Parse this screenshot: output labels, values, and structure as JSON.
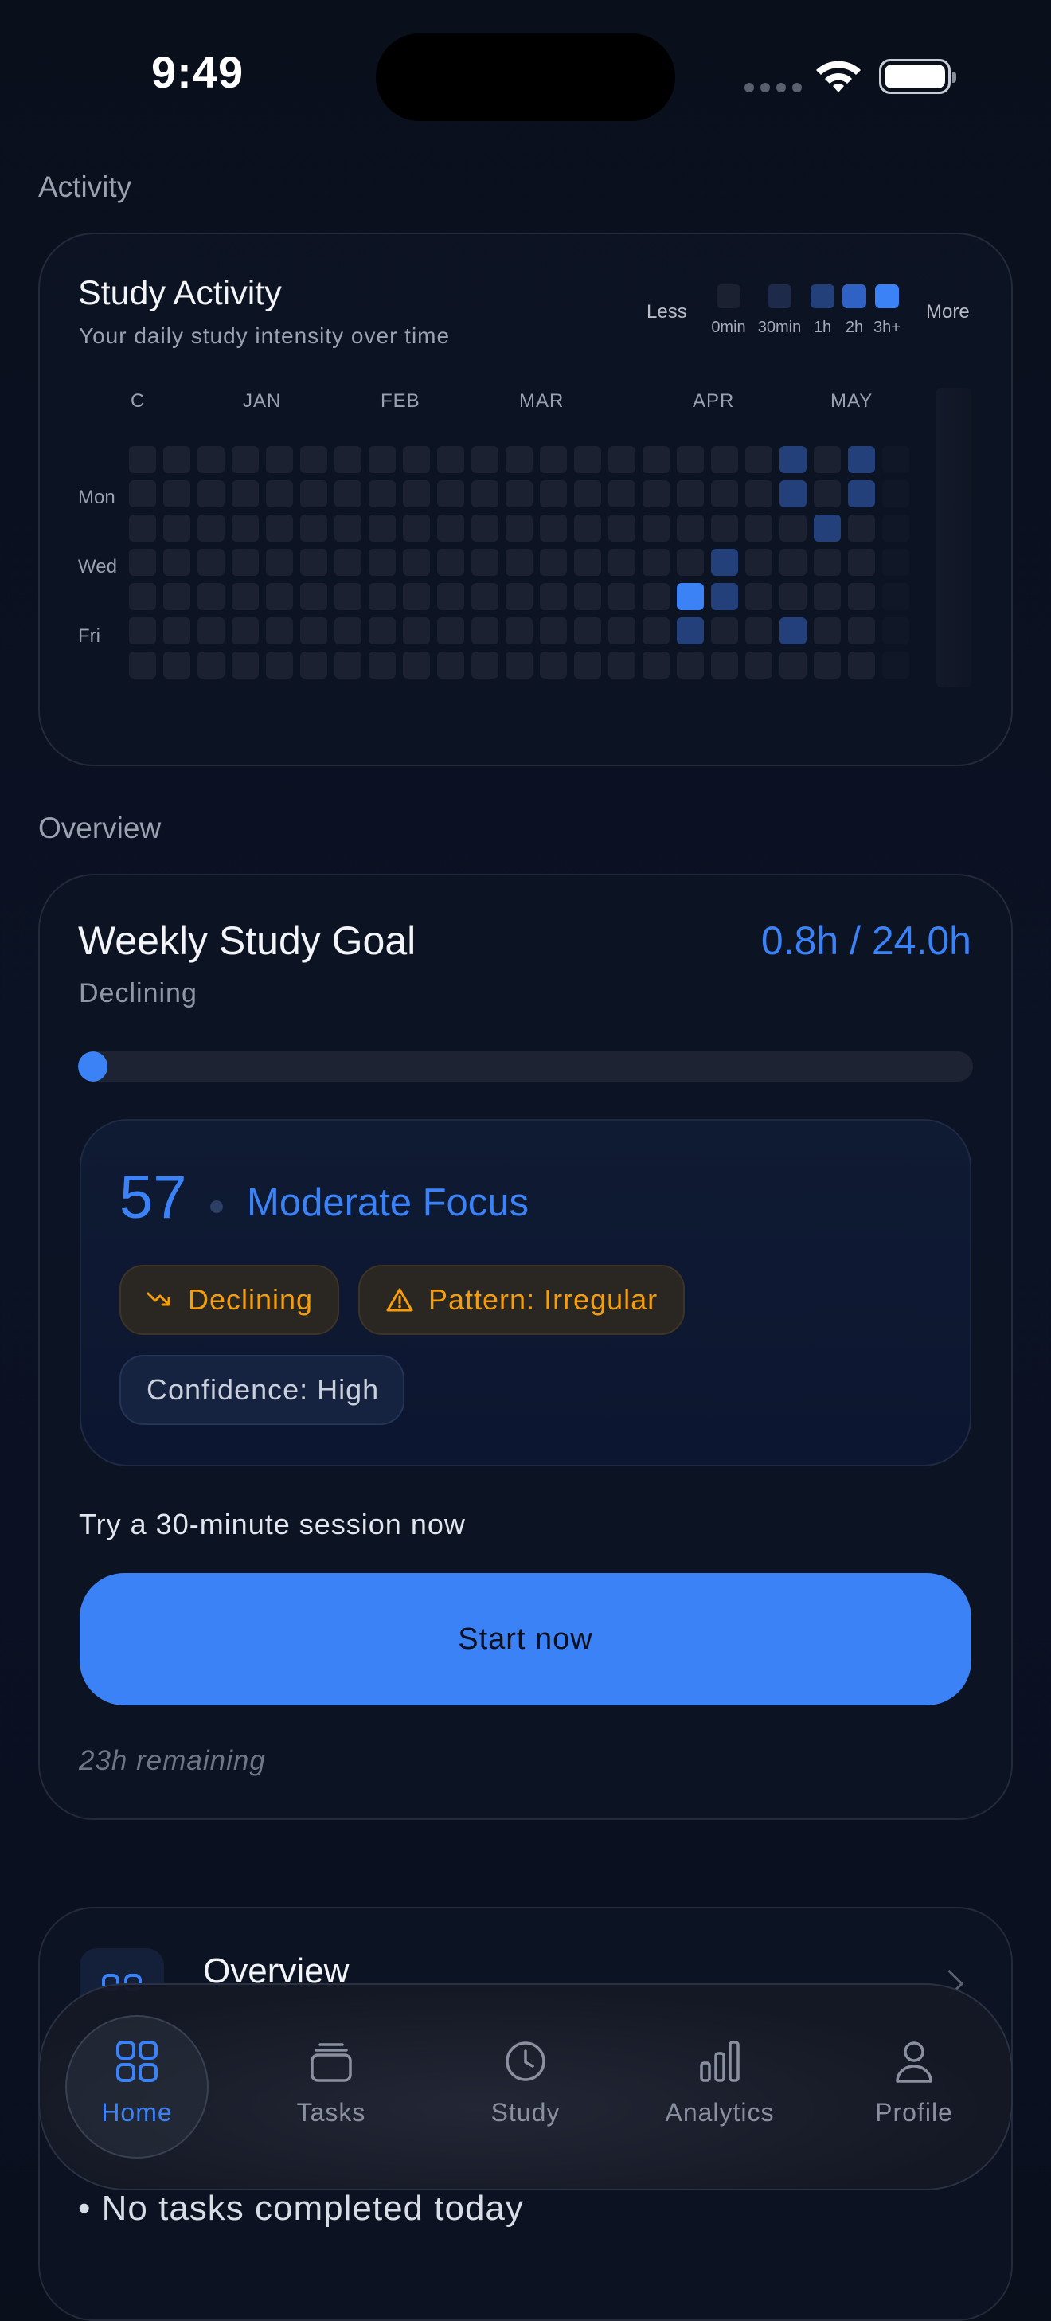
{
  "status_bar": {
    "time": "9:49"
  },
  "activity": {
    "section_label": "Activity",
    "title": "Study Activity",
    "subtitle": "Your daily study intensity over time",
    "legend": {
      "less": "Less",
      "more": "More",
      "levels": [
        "0min",
        "30min",
        "1h",
        "2h",
        "3h+"
      ],
      "colors": [
        "#1b2130",
        "#1e2a4a",
        "#23407a",
        "#2f62c4",
        "#3b82f6"
      ]
    },
    "months": [
      "C",
      "JAN",
      "FEB",
      "MAR",
      "APR",
      "MAY"
    ],
    "days": [
      "Mon",
      "Wed",
      "Fri"
    ],
    "highlights": [
      {
        "col": 19,
        "row": 0,
        "level": 2
      },
      {
        "col": 21,
        "row": 0,
        "level": 2
      },
      {
        "col": 19,
        "row": 1,
        "level": 2
      },
      {
        "col": 21,
        "row": 1,
        "level": 2
      },
      {
        "col": 20,
        "row": 2,
        "level": 2
      },
      {
        "col": 17,
        "row": 3,
        "level": 2
      },
      {
        "col": 16,
        "row": 4,
        "level": 4
      },
      {
        "col": 17,
        "row": 4,
        "level": 2
      },
      {
        "col": 16,
        "row": 5,
        "level": 2
      },
      {
        "col": 19,
        "row": 5,
        "level": 2
      }
    ]
  },
  "overview": {
    "section_label": "Overview",
    "goal_title": "Weekly Study Goal",
    "goal_value": "0.8h / 24.0h",
    "goal_status": "Declining",
    "progress_fraction": 0.033,
    "focus_score": "57",
    "focus_label": "Moderate Focus",
    "chips": {
      "trend": "Declining",
      "pattern": "Pattern: Irregular",
      "confidence": "Confidence: High"
    },
    "suggestion": "Try a 30-minute session now",
    "start_button": "Start now",
    "remaining": "23h remaining"
  },
  "overview_card": {
    "title": "Overview",
    "item": "• No tasks completed today"
  },
  "nav": {
    "items": [
      {
        "label": "Home",
        "icon": "grid-icon",
        "active": true
      },
      {
        "label": "Tasks",
        "icon": "stack-icon",
        "active": false
      },
      {
        "label": "Study",
        "icon": "clock-icon",
        "active": false
      },
      {
        "label": "Analytics",
        "icon": "bar-chart-icon",
        "active": false
      },
      {
        "label": "Profile",
        "icon": "person-icon",
        "active": false
      }
    ]
  }
}
